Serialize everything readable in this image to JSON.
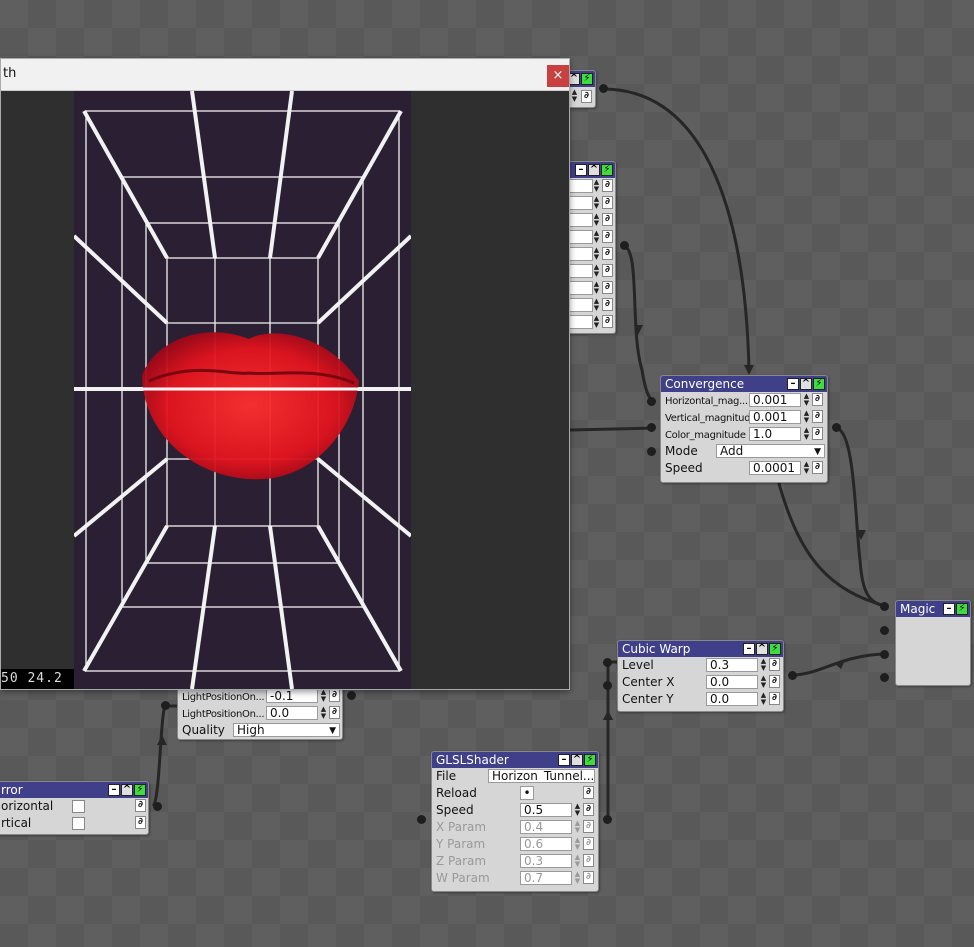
{
  "colors": {
    "header": "#3f3f8a",
    "wire": "#262626",
    "close": "#c94040",
    "bolt": "#3fdc3f",
    "lips": "#e0202a"
  },
  "icons": {
    "minimize": "minimize-icon",
    "visibility": "eye-icon",
    "active": "bolt-icon",
    "link": "link-icon",
    "close": "close-icon",
    "spinner": "spinner-arrows-icon",
    "dropdown": "chevron-down-icon"
  },
  "window": {
    "title": "th",
    "close_label": "×",
    "fps_text": "50  24.2"
  },
  "convergence": {
    "title": "Convergence",
    "rows": [
      {
        "label": "Horizontal_mag...",
        "value": "0.001"
      },
      {
        "label": "Vertical_magnitude",
        "value": "0.001"
      },
      {
        "label": "Color_magnitude",
        "value": "1.0"
      },
      {
        "label": "Mode",
        "value": "Add"
      },
      {
        "label": "Speed",
        "value": "0.0001"
      }
    ]
  },
  "magic": {
    "title": "Magic"
  },
  "cubic_warp": {
    "title": "Cubic Warp",
    "rows": [
      {
        "label": "Level",
        "value": "0.3"
      },
      {
        "label": "Center X",
        "value": "0.0"
      },
      {
        "label": "Center Y",
        "value": "0.0"
      }
    ]
  },
  "glsl": {
    "title": "GLSLShader",
    "rows": [
      {
        "label": "File",
        "value": "Horizon_Tunnel..."
      },
      {
        "label": "Reload",
        "value": "•"
      },
      {
        "label": "Speed",
        "value": "0.5"
      },
      {
        "label": "X Param",
        "value": "0.4"
      },
      {
        "label": "Y Param",
        "value": "0.6"
      },
      {
        "label": "Z Param",
        "value": "0.3"
      },
      {
        "label": "W Param",
        "value": "0.7"
      }
    ]
  },
  "light_node": {
    "rows": [
      {
        "label": "LightPositionOn...",
        "value": "-0.1"
      },
      {
        "label": "LightPositionOn...",
        "value": "0.0"
      },
      {
        "label": "Quality",
        "value": "High"
      }
    ]
  },
  "mirror": {
    "title": "rror",
    "rows": [
      {
        "label": "orizontal"
      },
      {
        "label": "rtical"
      }
    ]
  }
}
